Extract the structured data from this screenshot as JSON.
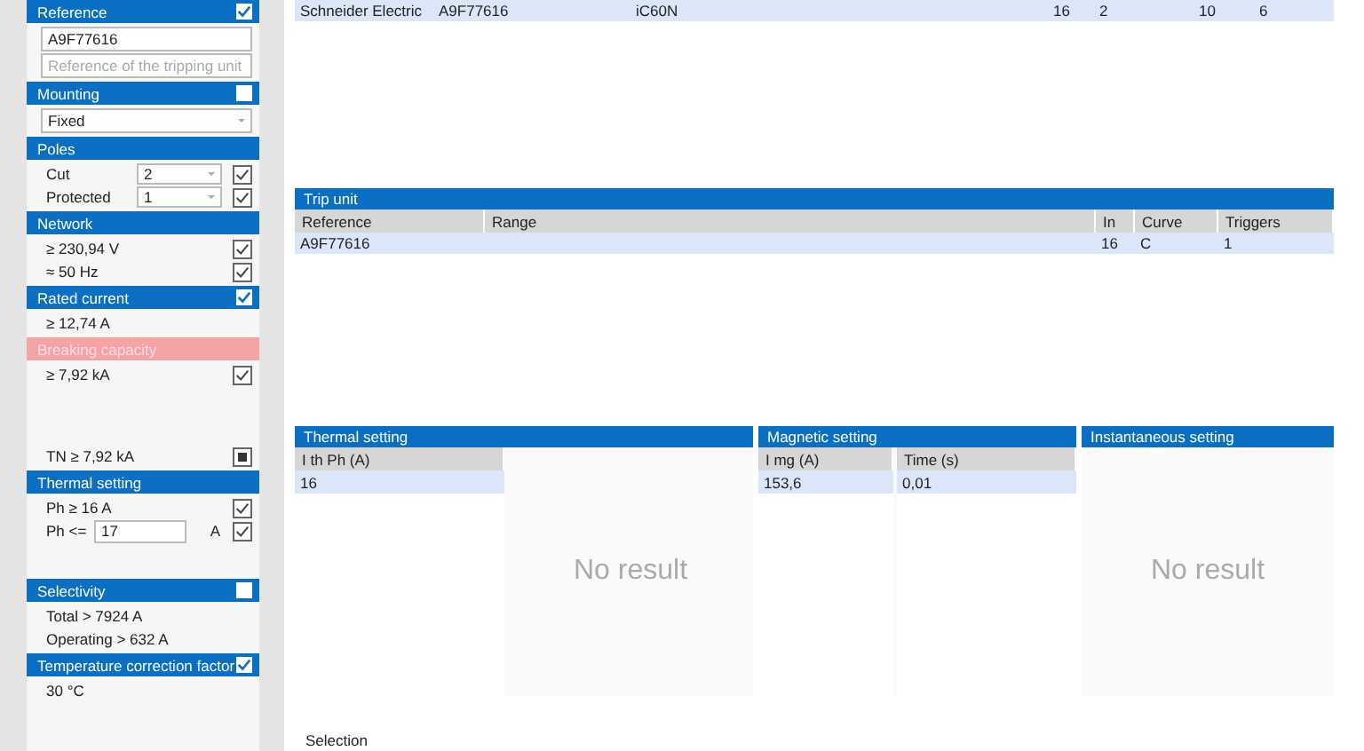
{
  "sidebar": {
    "sections": [
      {
        "title": "Reference",
        "checked": true,
        "error": false,
        "rows": [
          {
            "kind": "input",
            "value": "A9F77616"
          },
          {
            "kind": "input",
            "placeholder": "Reference of the tripping unit"
          }
        ]
      },
      {
        "title": "Mounting",
        "checked": false,
        "error": false,
        "rows": [
          {
            "kind": "select",
            "value": "Fixed"
          }
        ]
      },
      {
        "title": "Poles",
        "error": false,
        "rows": [
          {
            "kind": "select-row",
            "label": "Cut",
            "value": "2",
            "checked": true
          },
          {
            "kind": "select-row",
            "label": "Protected",
            "value": "1",
            "checked": true
          }
        ]
      },
      {
        "title": "Network",
        "error": false,
        "rows": [
          {
            "kind": "check",
            "label": "≥ 230,94 V",
            "checked": true
          },
          {
            "kind": "check",
            "label": "≈ 50 Hz",
            "checked": true
          }
        ]
      },
      {
        "title": "Rated current",
        "checked": true,
        "error": false,
        "rows": [
          {
            "kind": "text",
            "label": "≥ 12,74 A"
          }
        ]
      },
      {
        "title": "Breaking capacity",
        "error": true,
        "rows": [
          {
            "kind": "check",
            "label": "≥ 7,92 kA",
            "checked": true
          },
          {
            "kind": "check",
            "label": "TN ≥ 7,92 kA",
            "indeterminate": true
          }
        ]
      },
      {
        "title": "Thermal setting",
        "error": false,
        "rows": [
          {
            "kind": "check",
            "label": "Ph ≥ 16 A",
            "checked": true
          },
          {
            "kind": "input-row",
            "label": "Ph <=",
            "value": "17",
            "unit": "A",
            "checked": true
          }
        ]
      },
      {
        "title": "Selectivity",
        "checked": false,
        "error": false,
        "rows": [
          {
            "kind": "text",
            "label": "Total > 7924 A"
          },
          {
            "kind": "text",
            "label": "Operating > 632 A"
          }
        ]
      },
      {
        "title": "Temperature correction factor",
        "checked": true,
        "error": false,
        "rows": [
          {
            "kind": "text",
            "label": "30 °C"
          }
        ]
      }
    ]
  },
  "top_table": {
    "rows": [
      [
        "Schneider Electric",
        "A9F77616",
        "iC60N",
        "16",
        "2",
        "10",
        "6"
      ]
    ]
  },
  "trip_unit": {
    "title": "Trip unit",
    "columns": [
      "Reference",
      "Range",
      "In",
      "Curve",
      "Triggers"
    ],
    "rows": [
      [
        "A9F77616",
        "",
        "16",
        "C",
        "1"
      ]
    ]
  },
  "thermal_setting": {
    "title": "Thermal setting",
    "columns": [
      "I th Ph (A)"
    ],
    "rows": [
      [
        "16"
      ]
    ],
    "empty_message": "No result"
  },
  "magnetic_setting": {
    "title": "Magnetic setting",
    "columns": [
      "I mg (A)",
      "Time (s)"
    ],
    "rows": [
      [
        "153,6",
        "0,01"
      ]
    ]
  },
  "instantaneous_setting": {
    "title": "Instantaneous setting",
    "empty_message": "No result"
  },
  "selection": {
    "title": "Selection"
  }
}
